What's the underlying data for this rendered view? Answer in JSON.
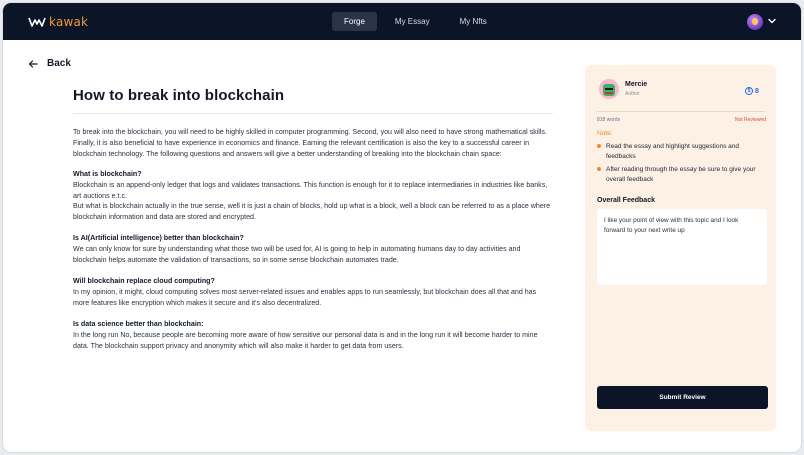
{
  "app": {
    "logo_text": "kawak"
  },
  "nav": {
    "tabs": [
      "Forge",
      "My Essay",
      "My Nfts"
    ],
    "active": "Forge"
  },
  "back": {
    "label": "Back"
  },
  "article": {
    "title": "How to break into blockchain",
    "intro": "To break into the blockchain, you will need to be highly skilled in computer programming. Second, you will also need to have strong mathematical skills. Finally, it is also beneficial to have experience in economics and finance. Earning the relevant certification is also the key to a successful career in blockchain technology. The following questions and answers will give a better understanding of breaking into the blockchain chain space:",
    "sections": [
      {
        "heading": "What is blockchain?",
        "text": "Blockchain is an append-only ledger that logs and validates transactions. This function is enough for it to replace intermediaries in industries like banks, art auctions e.t.c.",
        "text2": "But what is blockchain actually in the true sense, well it is just a chain of blocks, hold up what is a block, well a block can be referred to as a place where blockchain information and data are stored and encrypted."
      },
      {
        "heading": "Is AI(Artificial intelligence) better than blockchain?",
        "text": "We can only know for sure by understanding what those two will be used for, AI is going to help in automating humans day to day activities and blockchain helps automate the validation of transactions,  so in some sense blockchain automates trade."
      },
      {
        "heading": "Will blockchain replace cloud computing?",
        "text": "In my opinion, it might, cloud computing solves most server-related issues and enables apps to run seamlessly, but blockchain does all that and has more features like encryption which makes it secure and it's also decentralized."
      },
      {
        "heading": "Is data science better than blockchain:",
        "text": "In the long run No, because people are becoming more aware of how sensitive our personal data is and in the long run it will become harder to mine data. The blockchain support privacy and anonymity which will also make it harder to get data from users."
      }
    ]
  },
  "review": {
    "reviewer_name": "Mercie",
    "reviewer_role": "Author",
    "badge_count": "8",
    "word_count": "818 words",
    "status": "Not Reviewed",
    "note_label": "Note:",
    "notes": [
      "Read the essay and highlight suggestions and feedbacks",
      "After reading through the essay be sure to give your overall feedback"
    ],
    "feedback_label": "Overall Feedback",
    "feedback_text": "I like your point of view with this topic and  I look forward  to your next write up",
    "submit_label": "Submit Review"
  },
  "icons": {
    "logo": "kawak-logo-icon",
    "back": "arrow-left-icon",
    "user_menu": "chevron-down-icon",
    "badge": "token-icon"
  },
  "colors": {
    "nav_bg": "#0c1427",
    "accent_orange": "#f09a3a",
    "panel_bg": "#fdf1e6",
    "status_red": "#e04a3a",
    "badge_blue": "#2d6cdf"
  }
}
